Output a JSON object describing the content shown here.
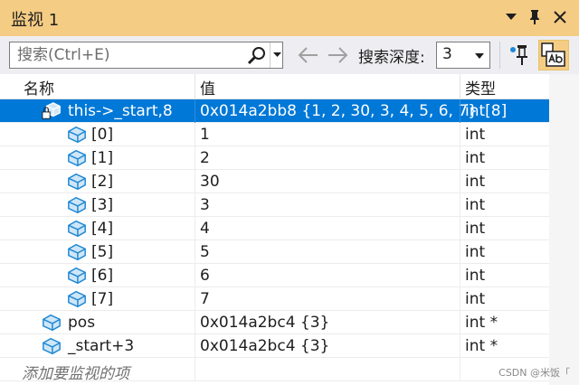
{
  "window": {
    "title": "监视 1"
  },
  "toolbar": {
    "search_placeholder": "搜索(Ctrl+E)",
    "depth_label": "搜索深度:",
    "depth_value": "3"
  },
  "grid": {
    "columns": [
      "名称",
      "值",
      "类型"
    ],
    "rows": [
      {
        "name": "this->_start,8",
        "value": "0x014a2bb8 {1, 2, 30, 3, 4, 5, 6, 7}",
        "type": "int[8]"
      },
      {
        "name": "[0]",
        "value": "1",
        "type": "int"
      },
      {
        "name": "[1]",
        "value": "2",
        "type": "int"
      },
      {
        "name": "[2]",
        "value": "30",
        "type": "int"
      },
      {
        "name": "[3]",
        "value": "3",
        "type": "int"
      },
      {
        "name": "[4]",
        "value": "4",
        "type": "int"
      },
      {
        "name": "[5]",
        "value": "5",
        "type": "int"
      },
      {
        "name": "[6]",
        "value": "6",
        "type": "int"
      },
      {
        "name": "[7]",
        "value": "7",
        "type": "int"
      },
      {
        "name": "pos",
        "value": "0x014a2bc4 {3}",
        "type": "int *"
      },
      {
        "name": "_start+3",
        "value": "0x014a2bc4 {3}",
        "type": "int *"
      }
    ],
    "add_placeholder": "添加要监视的项"
  },
  "watermark": "CSDN @米饭「",
  "colors": {
    "accent": "#f5cc84",
    "selection": "#0078d7",
    "icon_blue": "#1e88d4"
  }
}
